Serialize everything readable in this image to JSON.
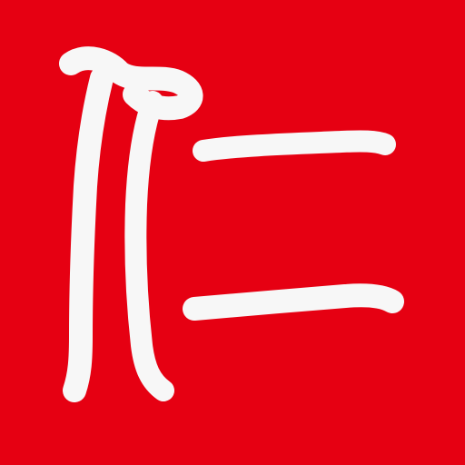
{
  "app_icon": {
    "icon_name": "ren-character-logo-icon",
    "character": "仁",
    "colors": {
      "background": "#e60012",
      "glyph": "#f7f7f7"
    }
  }
}
